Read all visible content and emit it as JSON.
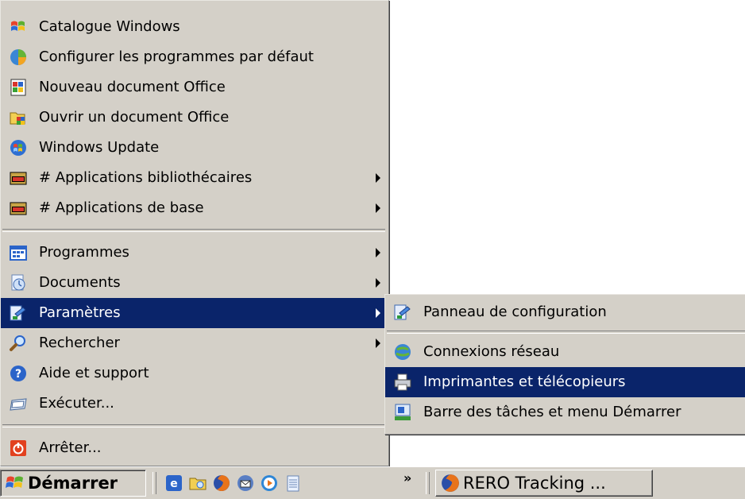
{
  "start_menu": {
    "pinned": [
      {
        "label": "Catalogue Windows",
        "icon": "windows-catalog-icon"
      },
      {
        "label": "Configurer les programmes par défaut",
        "icon": "default-programs-icon"
      },
      {
        "label": "Nouveau document Office",
        "icon": "new-office-document-icon"
      },
      {
        "label": "Ouvrir un document Office",
        "icon": "open-office-document-icon"
      },
      {
        "label": "Windows Update",
        "icon": "windows-update-icon"
      },
      {
        "label": "# Applications bibliothécaires",
        "icon": "folder-icon"
      },
      {
        "label": "# Applications de base",
        "icon": "folder-icon"
      }
    ],
    "main": [
      {
        "label": "Programmes",
        "icon": "programs-icon"
      },
      {
        "label": "Documents",
        "icon": "documents-icon"
      },
      {
        "label": "Paramètres",
        "icon": "settings-icon"
      },
      {
        "label": "Rechercher",
        "icon": "search-icon"
      },
      {
        "label": "Aide et support",
        "icon": "help-icon"
      },
      {
        "label": "Exécuter...",
        "icon": "run-icon"
      }
    ],
    "shutdown": {
      "label": "Arrêter...",
      "icon": "shutdown-icon"
    }
  },
  "settings_submenu": {
    "items": [
      {
        "label": "Panneau de configuration",
        "icon": "control-panel-icon"
      },
      {
        "label": "Connexions réseau",
        "icon": "network-connections-icon"
      },
      {
        "label": "Imprimantes et télécopieurs",
        "icon": "printers-icon"
      },
      {
        "label": "Barre des tâches et menu Démarrer",
        "icon": "taskbar-settings-icon"
      }
    ]
  },
  "taskbar": {
    "start_label": "Démarrer",
    "quick_launch_icons": [
      "ie-icon",
      "explorer-icon",
      "firefox-icon",
      "thunderbird-icon",
      "media-player-icon",
      "notepad-icon"
    ],
    "overflow_label": "»",
    "task_label": "RERO Tracking ..."
  },
  "colors": {
    "menu_bg": "#d4d0c8",
    "highlight": "#0a246a",
    "highlight_text": "#ffffff"
  }
}
